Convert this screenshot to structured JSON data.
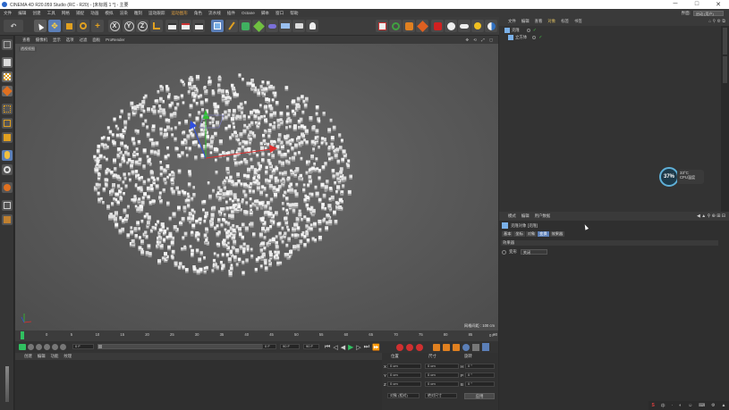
{
  "window": {
    "title": "CINEMA 4D R20.059 Studio (RC - R20) - [未标题 1 *] - 主要",
    "minimize": "─",
    "maximize": "□",
    "close": "✕"
  },
  "menubar": {
    "items": [
      "文件",
      "编辑",
      "创建",
      "工具",
      "网格",
      "捕捉",
      "动画",
      "模拟",
      "渲染",
      "雕刻",
      "运动跟踪",
      "运动图形",
      "角色",
      "流水线",
      "插件",
      "Octane",
      "脚本",
      "窗口",
      "帮助"
    ],
    "layout_label": "界面:",
    "layout_value": "启动 (用户)"
  },
  "toolbar": {
    "undo": "↶",
    "axis_x": "X",
    "axis_y": "Y",
    "axis_z": "Z"
  },
  "viewport": {
    "menus": [
      "查看",
      "摄像机",
      "显示",
      "选项",
      "过滤",
      "面板",
      "ProRender"
    ],
    "camera_label": "透视视图",
    "grid_scale": "网格间距 : 100 cm",
    "nav_icons": "✥ ⟲ ⤢ ▢",
    "axis_x": "X",
    "axis_y": "Y",
    "axis_z": "Z"
  },
  "timeline": {
    "ticks": [
      "0",
      "5",
      "10",
      "15",
      "20",
      "25",
      "30",
      "35",
      "40",
      "45",
      "50",
      "55",
      "60",
      "65",
      "70",
      "75",
      "80",
      "85",
      "90"
    ],
    "end_frame": "0 F"
  },
  "transport": {
    "start_field": "0 F",
    "current_field": "0 F",
    "end_field": "90 F",
    "max_field": "90 F"
  },
  "material_panel": {
    "menus": [
      "创建",
      "编辑",
      "功能",
      "纹理"
    ]
  },
  "coord_panel": {
    "headers": [
      "位置",
      "尺寸",
      "旋转"
    ],
    "rows": [
      {
        "axis": "X",
        "pos": "0 cm",
        "size": "0 cm",
        "rot_axis": "H",
        "rot": "0 °"
      },
      {
        "axis": "Y",
        "pos": "0 cm",
        "size": "0 cm",
        "rot_axis": "P",
        "rot": "0 °"
      },
      {
        "axis": "Z",
        "pos": "0 cm",
        "size": "0 cm",
        "rot_axis": "B",
        "rot": "0 °"
      }
    ],
    "mode_select": "对象 (相对)",
    "size_select": "绝对尺寸",
    "apply_button": "应用"
  },
  "object_manager": {
    "menus": [
      "文件",
      "编辑",
      "查看",
      "对象",
      "标签",
      "书签"
    ],
    "objects": [
      {
        "name": "克隆"
      },
      {
        "name": "立方体"
      }
    ]
  },
  "attribute_manager": {
    "menus": [
      "模式",
      "编辑",
      "用户数据"
    ],
    "object_title": "克隆对象 [克隆]",
    "tabs": [
      "基本",
      "坐标",
      "对象",
      "变换",
      "效果器"
    ],
    "active_tab": "对象",
    "section_title": "效果器",
    "field_label": "变形",
    "field_value": "关闭"
  },
  "cpu_widget": {
    "percent": "37%",
    "temp": "33°C",
    "label": "CPU温度"
  },
  "taskbar": {
    "items": [
      "S",
      "中",
      "·",
      "◐",
      "☺",
      "⌨",
      "⚙",
      "▲"
    ]
  },
  "colors": {
    "accent_blue": "#5b7fb8",
    "viewport_bg": "#5a5a5a",
    "cube_color": "#e8e8e8",
    "axis_red": "#e03030",
    "axis_green": "#30c030",
    "axis_blue": "#3050e0"
  }
}
